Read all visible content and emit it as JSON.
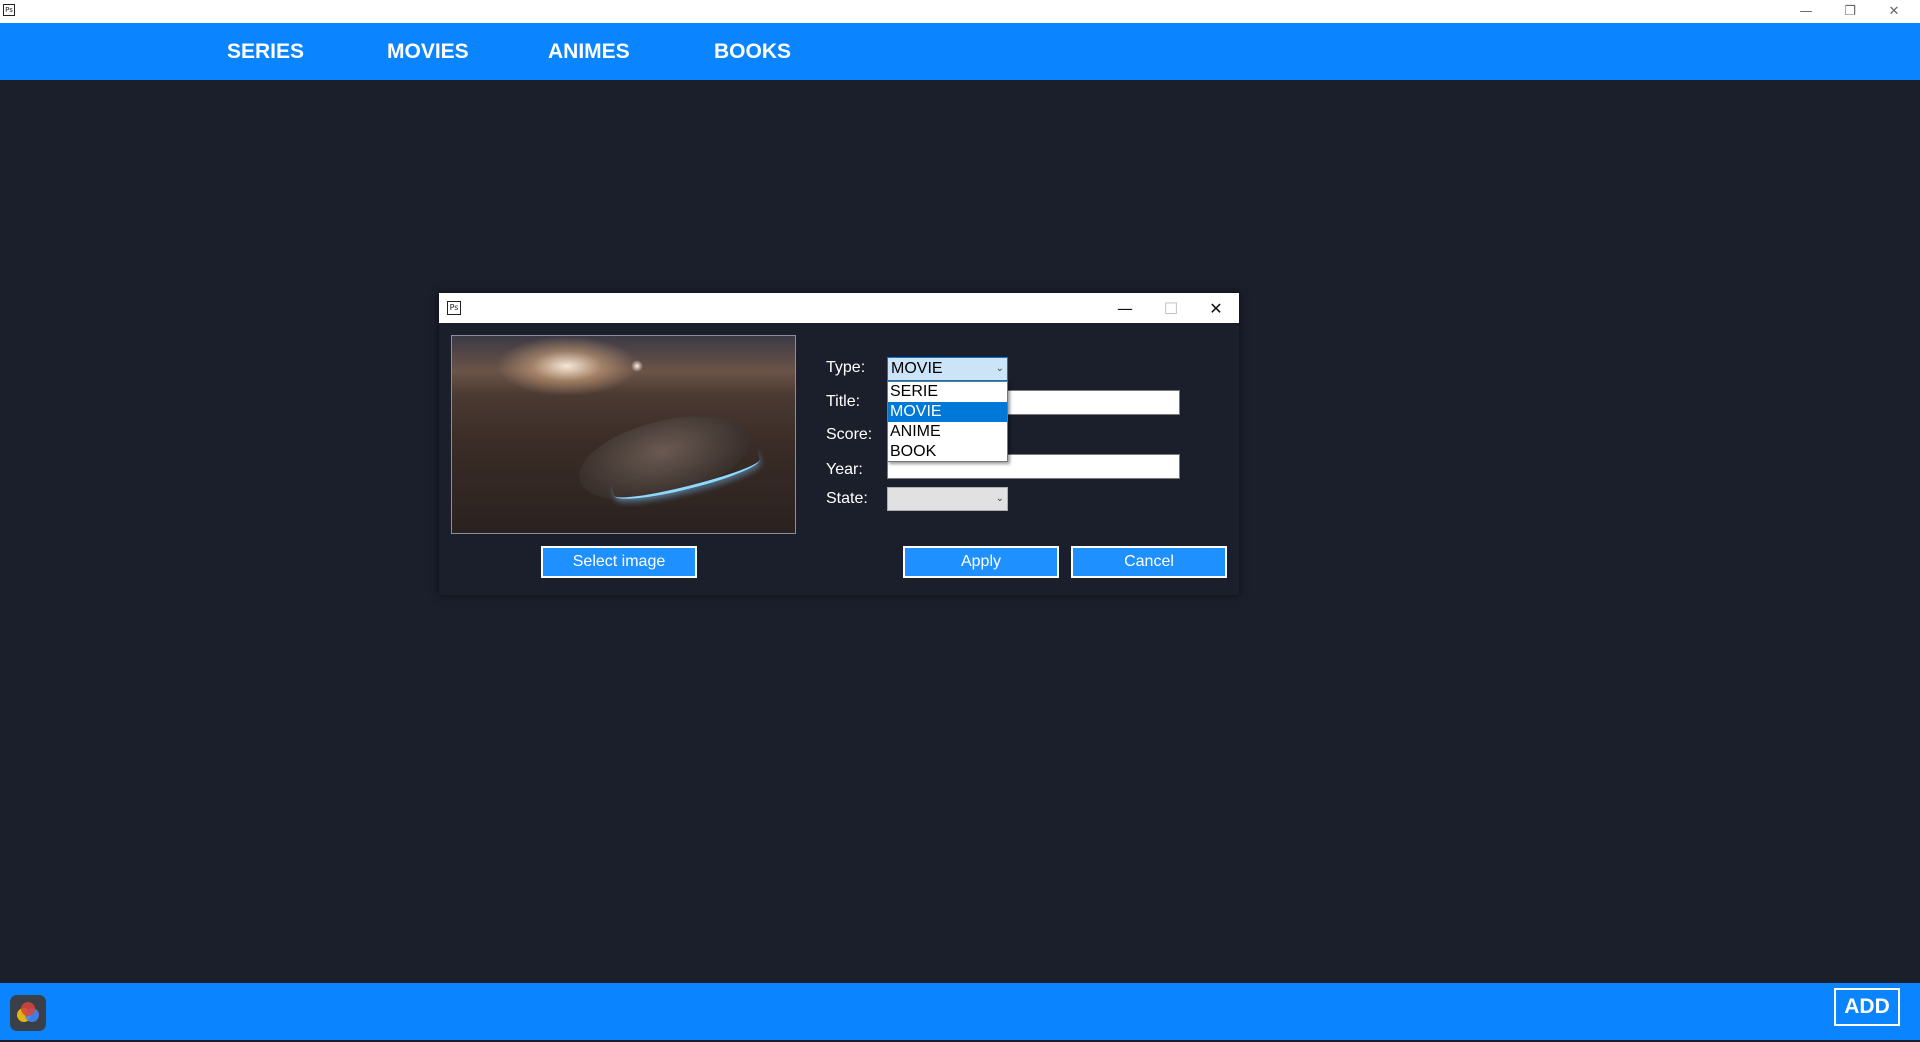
{
  "window": {
    "minimize_icon": "minimize-icon",
    "restore_icon": "restore-icon",
    "close_icon": "close-icon",
    "min_glyph": "—",
    "restore_glyph": "❐",
    "close_glyph": "✕"
  },
  "nav": {
    "items": [
      {
        "label": "SERIES"
      },
      {
        "label": "MOVIES"
      },
      {
        "label": "ANIMES"
      },
      {
        "label": "BOOKS"
      }
    ]
  },
  "dialog": {
    "min_glyph": "—",
    "max_glyph": "☐",
    "close_glyph": "✕",
    "select_image_label": "Select image",
    "apply_label": "Apply",
    "cancel_label": "Cancel",
    "fields": {
      "type_label": "Type:",
      "title_label": "Title:",
      "score_label": "Score:",
      "year_label": "Year:",
      "state_label": "State:"
    },
    "type_value": "MOVIE",
    "type_options": [
      "SERIE",
      "MOVIE",
      "ANIME",
      "BOOK"
    ],
    "type_selected_index": 1,
    "title_value": "",
    "year_value": "",
    "state_value": ""
  },
  "bottom": {
    "add_label": "ADD"
  },
  "colors": {
    "accent": "#0a84ff",
    "background": "#1b1f2c",
    "selection": "#0078d7"
  }
}
